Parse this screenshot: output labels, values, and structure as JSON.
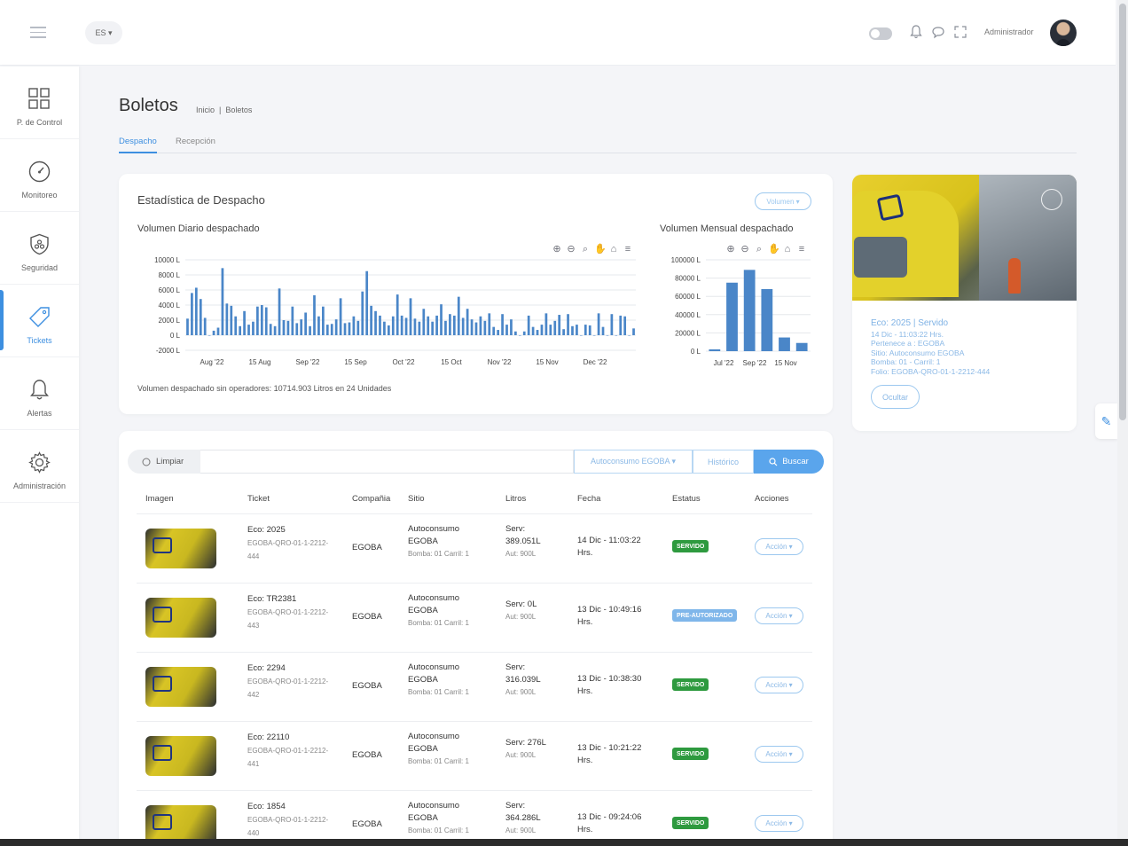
{
  "topbar": {
    "lang": "ES ▾",
    "admin": "Administrador"
  },
  "sidebar": {
    "items": [
      {
        "label": "P. de Control"
      },
      {
        "label": "Monitoreo"
      },
      {
        "label": "Seguridad"
      },
      {
        "label": "Tickets"
      },
      {
        "label": "Alertas"
      },
      {
        "label": "Administración"
      }
    ]
  },
  "header": {
    "title": "Boletos",
    "breadcrumb": [
      "Inicio",
      "|",
      "Boletos"
    ],
    "tabs": [
      "Despacho",
      "Recepción"
    ]
  },
  "stats": {
    "title": "Estadística de Despacho",
    "volume_btn": "Volumen ▾",
    "daily_title": "Volumen Diario despachado",
    "monthly_title": "Volumen Mensual despachado",
    "footnote": "Volumen despachado sin operadores: 10714.903 Litros en 24 Unidades"
  },
  "chart_data": [
    {
      "type": "bar",
      "title": "Volumen Diario despachado",
      "y_ticks": [
        "10000 L",
        "8000 L",
        "6000 L",
        "4000 L",
        "2000 L",
        "0 L",
        "-2000 L"
      ],
      "ylim": [
        -2000,
        10000
      ],
      "x_ticks": [
        "Aug '22",
        "15 Aug",
        "Sep '22",
        "15 Sep",
        "Oct '22",
        "15 Oct",
        "Nov '22",
        "15 Nov",
        "Dec '22"
      ],
      "values": [
        2200,
        5600,
        6300,
        4800,
        2300,
        0,
        600,
        1000,
        8900,
        4200,
        3900,
        2500,
        1200,
        3200,
        1400,
        1800,
        3800,
        4000,
        3700,
        1500,
        1200,
        6200,
        2000,
        1900,
        3800,
        1600,
        2100,
        3000,
        1200,
        5300,
        2500,
        3800,
        1400,
        1500,
        2100,
        4900,
        1600,
        1700,
        2500,
        1900,
        5800,
        8500,
        3900,
        3200,
        2600,
        1800,
        1300,
        2500,
        5400,
        2600,
        2300,
        4900,
        2200,
        1800,
        3500,
        2500,
        1800,
        2600,
        4100,
        1900,
        2800,
        2600,
        5100,
        2300,
        3500,
        2100,
        1700,
        2500,
        1900,
        2900,
        1100,
        700,
        2800,
        1400,
        2100,
        500,
        0,
        500,
        2600,
        1100,
        700,
        1400,
        2900,
        1400,
        1900,
        2700,
        800,
        2800,
        1200,
        1400,
        0,
        1400,
        1300,
        0,
        2900,
        1100,
        0,
        2800,
        0,
        2600,
        2500,
        0,
        900
      ],
      "grid": true
    },
    {
      "type": "bar",
      "title": "Volumen Mensual despachado",
      "y_ticks": [
        "100000 L",
        "80000 L",
        "60000 L",
        "40000 L",
        "20000 L",
        "0 L"
      ],
      "ylim": [
        0,
        100000
      ],
      "x_ticks": [
        "Jul '22",
        "Sep '22",
        "15 Nov"
      ],
      "values": [
        2000,
        75000,
        89000,
        68000,
        15000,
        9000
      ],
      "grid": true
    }
  ],
  "photo": {
    "head": "Eco: 2025 | Servido",
    "lines": [
      "14 Dic - 11:03:22 Hrs.",
      "Pertenece a : EGOBA",
      "Sitio: Autoconsumo EGOBA",
      "Bomba: 01 - Carril: 1",
      "Folio: EGOBA-QRO-01-1-2212-444"
    ],
    "hide_btn": "Ocultar"
  },
  "filters": {
    "clear": "Limpiar",
    "site_select": "Autoconsumo EGOBA ▾",
    "history": "Histórico",
    "search": "Buscar"
  },
  "table": {
    "headers": [
      "Imagen",
      "Ticket",
      "Compañia",
      "Sitio",
      "Litros",
      "Fecha",
      "Estatus",
      "Acciones"
    ],
    "rows": [
      {
        "eco": "Eco: 2025",
        "folio1": "EGOBA-QRO-01-1-2212-",
        "folio2": "444",
        "company": "EGOBA",
        "site1": "Autoconsumo",
        "site2": "EGOBA",
        "pump": "Bomba: 01 Carril: 1",
        "serv1": "Serv:",
        "serv2": "389.051L",
        "aut": "Aut: 900L",
        "date1": "14 Dic - 11:03:22",
        "date2": "Hrs.",
        "status": "SERVIDO",
        "action": "Acción ▾"
      },
      {
        "eco": "Eco: TR2381",
        "folio1": "EGOBA-QRO-01-1-2212-",
        "folio2": "443",
        "company": "EGOBA",
        "site1": "Autoconsumo",
        "site2": "EGOBA",
        "pump": "Bomba: 01 Carril: 1",
        "serv1": "Serv: 0L",
        "serv2": "",
        "aut": "Aut: 900L",
        "date1": "13 Dic - 10:49:16",
        "date2": "Hrs.",
        "status": "PRE-AUTORIZADO",
        "action": "Acción ▾"
      },
      {
        "eco": "Eco: 2294",
        "folio1": "EGOBA-QRO-01-1-2212-",
        "folio2": "442",
        "company": "EGOBA",
        "site1": "Autoconsumo",
        "site2": "EGOBA",
        "pump": "Bomba: 01 Carril: 1",
        "serv1": "Serv:",
        "serv2": "316.039L",
        "aut": "Aut: 900L",
        "date1": "13 Dic - 10:38:30",
        "date2": "Hrs.",
        "status": "SERVIDO",
        "action": "Acción ▾"
      },
      {
        "eco": "Eco: 22110",
        "folio1": "EGOBA-QRO-01-1-2212-",
        "folio2": "441",
        "company": "EGOBA",
        "site1": "Autoconsumo",
        "site2": "EGOBA",
        "pump": "Bomba: 01 Carril: 1",
        "serv1": "Serv: 276L",
        "serv2": "",
        "aut": "Aut: 900L",
        "date1": "13 Dic - 10:21:22",
        "date2": "Hrs.",
        "status": "SERVIDO",
        "action": "Acción ▾"
      },
      {
        "eco": "Eco: 1854",
        "folio1": "EGOBA-QRO-01-1-2212-",
        "folio2": "440",
        "company": "EGOBA",
        "site1": "Autoconsumo",
        "site2": "EGOBA",
        "pump": "Bomba: 01 Carril: 1",
        "serv1": "Serv:",
        "serv2": "364.286L",
        "aut": "Aut: 900L",
        "date1": "13 Dic - 09:24:06",
        "date2": "Hrs.",
        "status": "SERVIDO",
        "action": "Acción ▾"
      }
    ]
  }
}
